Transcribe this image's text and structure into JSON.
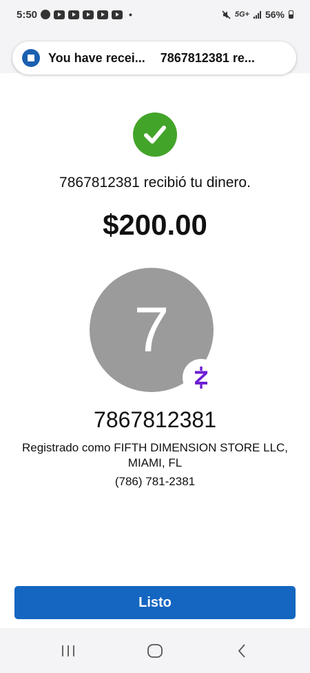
{
  "status_bar": {
    "time": "5:50",
    "dot": "•",
    "network": "5G+",
    "battery": "56%"
  },
  "notification": {
    "title": "You have recei...",
    "text": "7867812381 re...",
    "app_icon": "chase-icon"
  },
  "confirmation": {
    "message": "7867812381 recibió tu dinero.",
    "amount": "$200.00",
    "avatar_initial": "7",
    "recipient_name": "7867812381",
    "registered_as": "Registrado como FIFTH DIMENSION STORE LLC, MIAMI, FL",
    "phone": "(786) 781-2381",
    "check_color": "#43a42a",
    "avatar_color": "#9b9b9b",
    "badge_icon": "zelle-icon",
    "badge_color": "#6d1ed4"
  },
  "actions": {
    "done_label": "Listo",
    "button_color": "#1466c0"
  },
  "nav_bar": {
    "buttons": [
      "recents-icon",
      "home-icon",
      "back-icon"
    ]
  }
}
